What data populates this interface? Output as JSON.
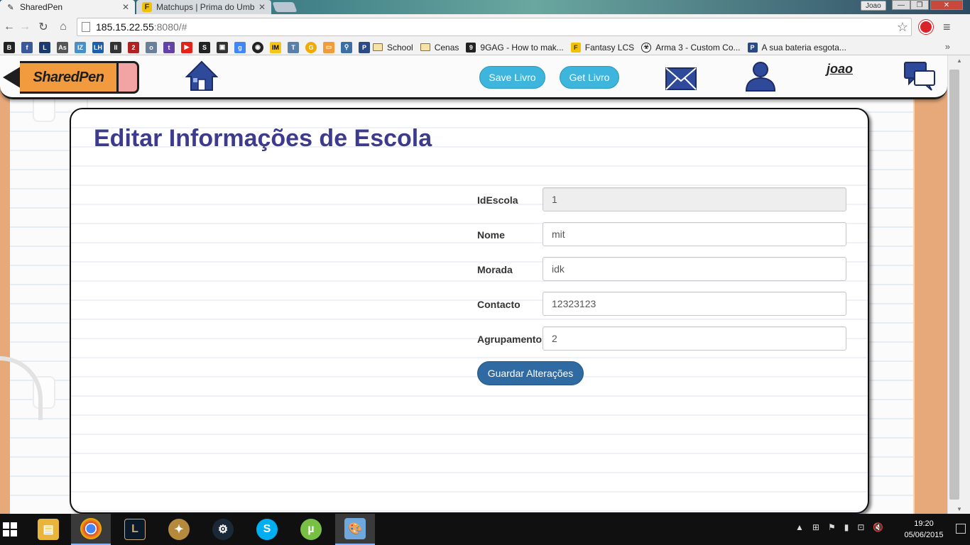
{
  "browser": {
    "tabs": [
      {
        "title": "SharedPen",
        "active": true
      },
      {
        "title": "Matchups | Prima do Umb",
        "active": false
      }
    ],
    "profile_name": "Joao",
    "url_host": "185.15.22.55",
    "url_rest": ":8080/#",
    "bookmarks": [
      {
        "label": "School",
        "type": "folder"
      },
      {
        "label": "Cenas",
        "type": "folder"
      },
      {
        "label": "9GAG - How to mak...",
        "type": "link"
      },
      {
        "label": "Fantasy LCS",
        "type": "link"
      },
      {
        "label": "Arma 3 - Custom Co...",
        "type": "link"
      },
      {
        "label": "A sua bateria esgota...",
        "type": "link"
      }
    ],
    "bookmark_more": "»"
  },
  "app": {
    "logo_text": "SharedPen",
    "save_livro": "Save Livro",
    "get_livro": "Get Livro",
    "username": "joao"
  },
  "page": {
    "title": "Editar Informações de Escola",
    "fields": [
      {
        "label": "IdEscola",
        "value": "1",
        "readonly": true
      },
      {
        "label": "Nome",
        "value": "mit",
        "readonly": false
      },
      {
        "label": "Morada",
        "value": "idk",
        "readonly": false
      },
      {
        "label": "Contacto",
        "value": "12323123",
        "readonly": false
      },
      {
        "label": "Agrupamento",
        "value": "2",
        "readonly": false
      }
    ],
    "save_button": "Guardar Alterações"
  },
  "taskbar": {
    "time": "19:20",
    "date": "05/06/2015"
  },
  "colors": {
    "accent_blue": "#3db5dc",
    "save_blue": "#2f6aa3",
    "title_purple": "#3d3b8e",
    "pencil_orange": "#f19a3e"
  }
}
